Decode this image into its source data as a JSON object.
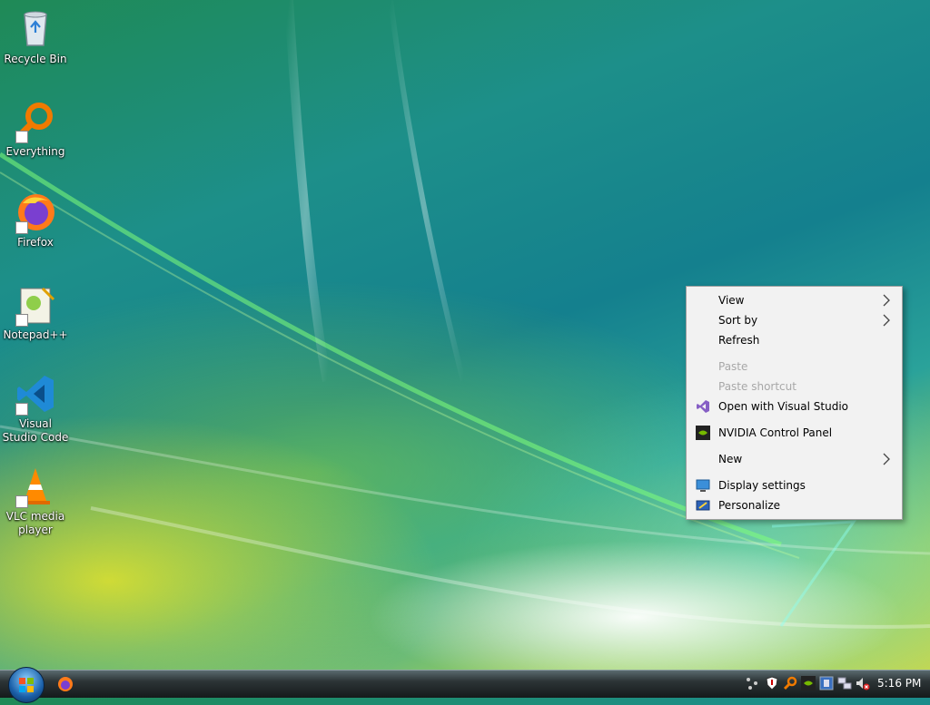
{
  "desktop": {
    "icons": [
      {
        "label": "Recycle Bin",
        "icon": "recycle-bin-icon"
      },
      {
        "label": "Everything",
        "icon": "everything-search-icon"
      },
      {
        "label": "Firefox",
        "icon": "firefox-icon"
      },
      {
        "label": "Notepad++",
        "icon": "notepad-plus-plus-icon"
      },
      {
        "label": "Visual Studio Code",
        "icon": "vscode-icon"
      },
      {
        "label": "VLC media player",
        "icon": "vlc-icon"
      }
    ]
  },
  "context_menu": {
    "items": [
      {
        "label": "View",
        "submenu": true,
        "enabled": true
      },
      {
        "label": "Sort by",
        "submenu": true,
        "enabled": true
      },
      {
        "label": "Refresh",
        "enabled": true
      },
      {
        "label": "Paste",
        "enabled": false
      },
      {
        "label": "Paste shortcut",
        "enabled": false
      },
      {
        "label": "Open with Visual Studio",
        "enabled": true,
        "icon": "visual-studio-icon"
      },
      {
        "label": "NVIDIA Control Panel",
        "enabled": true,
        "icon": "nvidia-icon"
      },
      {
        "label": "New",
        "submenu": true,
        "enabled": true
      },
      {
        "label": "Display settings",
        "enabled": true,
        "icon": "display-icon"
      },
      {
        "label": "Personalize",
        "enabled": true,
        "icon": "personalize-icon"
      }
    ]
  },
  "taskbar": {
    "pinned": [
      {
        "icon": "firefox-icon"
      }
    ],
    "tray_icons": [
      "network-activity-icon",
      "security-shield-icon",
      "everything-search-icon",
      "nvidia-icon",
      "system-app-icon",
      "network-icon",
      "volume-muted-icon"
    ],
    "clock": "5:16 PM"
  },
  "colors": {
    "menu_bg": "#f2f2f2",
    "disabled_text": "#a8a8a8",
    "taskbar_bg": "#1a2021"
  }
}
